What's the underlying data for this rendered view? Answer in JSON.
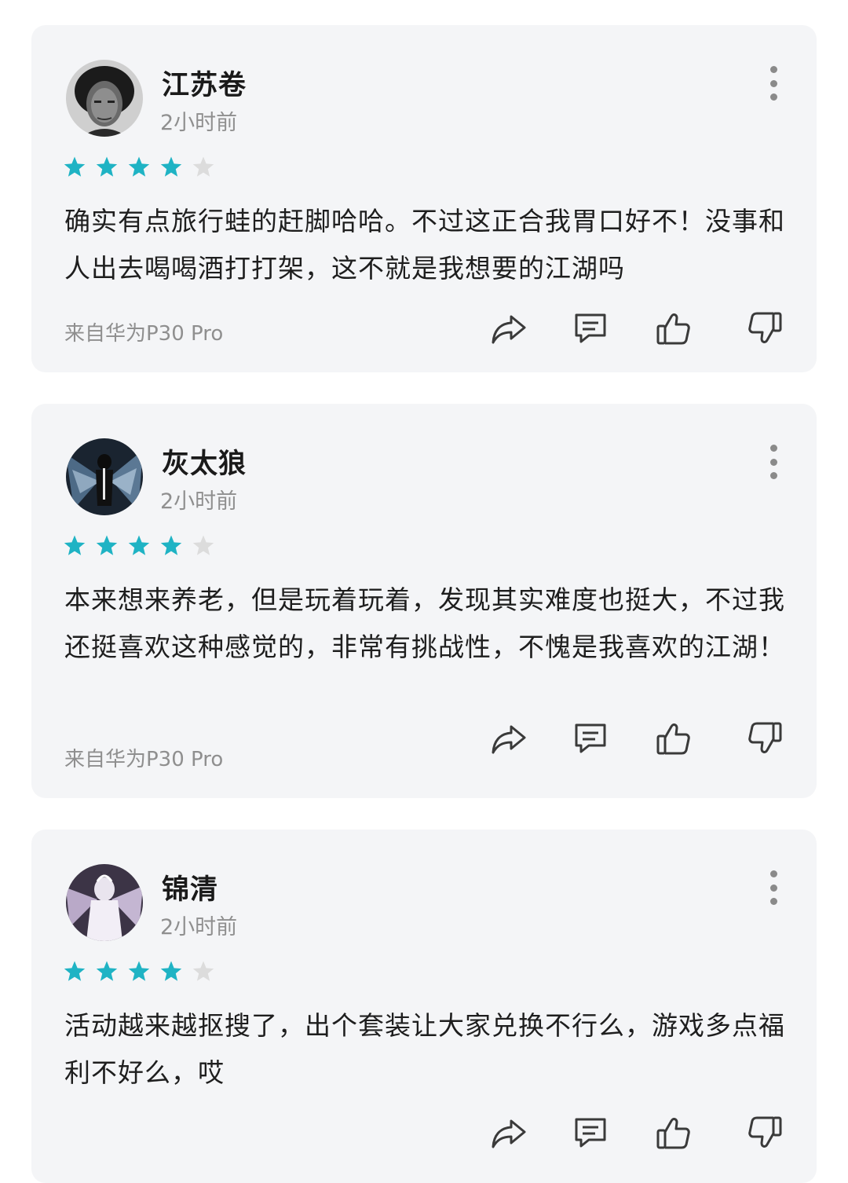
{
  "colors": {
    "star_filled": "#1fb3c4",
    "star_empty": "#dcdcdc",
    "card_bg": "#f4f5f7"
  },
  "reviews": [
    {
      "username": "江苏卷",
      "time": "2小时前",
      "rating": 4,
      "max_rating": 5,
      "text": "确实有点旅行蛙的赶脚哈哈。不过这正合我胃口好不！没事和人出去喝喝酒打打架，这不就是我想要的江湖吗",
      "device": "来自华为P30 Pro",
      "avatar": "portrait-photo"
    },
    {
      "username": "灰太狼",
      "time": "2小时前",
      "rating": 4,
      "max_rating": 5,
      "text": "本来想来养老，但是玩着玩着，发现其实难度也挺大，不过我还挺喜欢这种感觉的，非常有挑战性，不愧是我喜欢的江湖！",
      "device": "来自华为P30 Pro",
      "avatar": "dark-winged-figure"
    },
    {
      "username": "锦清",
      "time": "2小时前",
      "rating": 4,
      "max_rating": 5,
      "text": "活动越来越抠搜了，出个套装让大家兑换不行么，游戏多点福利不好么，哎",
      "device": "",
      "avatar": "white-angel-figure"
    }
  ],
  "actions": [
    "share-icon",
    "comment-icon",
    "thumbs-up-icon",
    "thumbs-down-icon"
  ]
}
